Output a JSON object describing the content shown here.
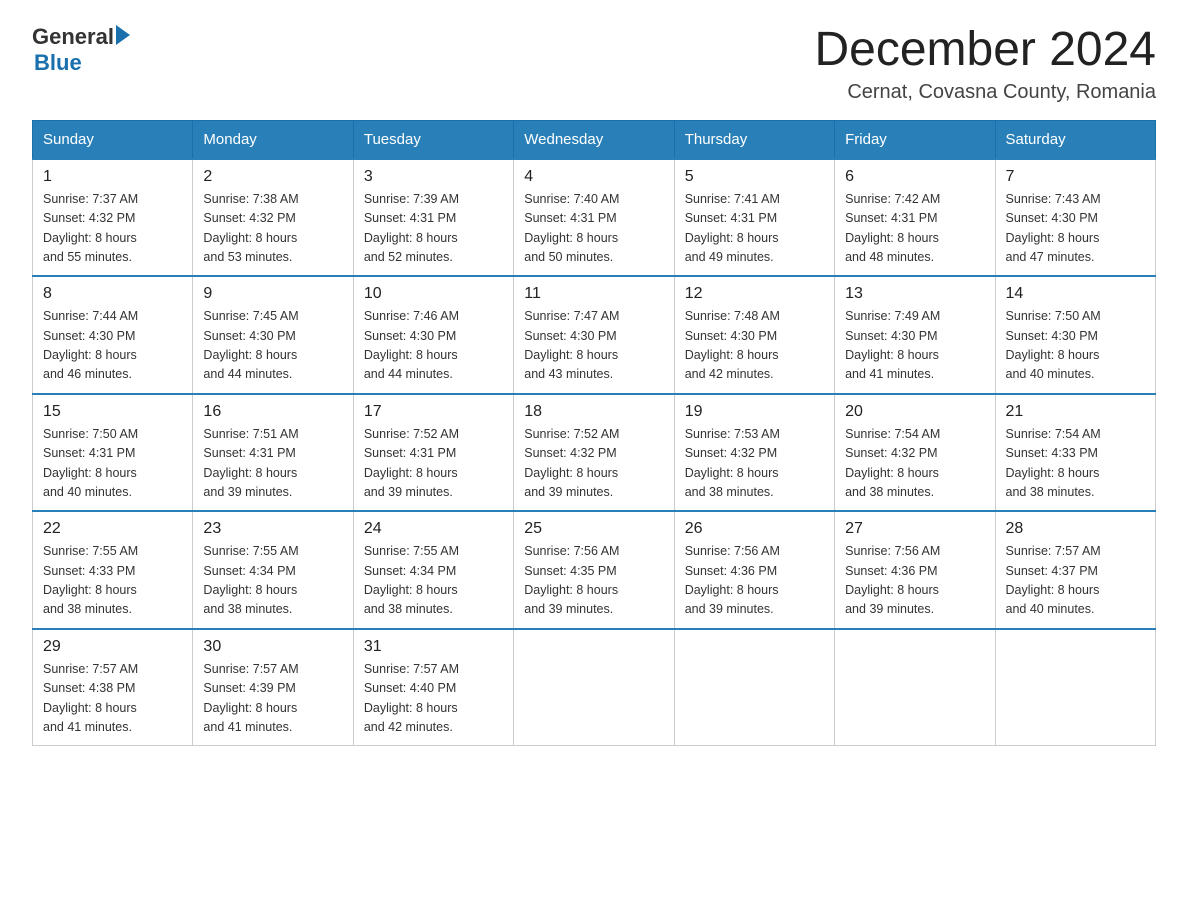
{
  "logo": {
    "text1": "General",
    "text2": "Blue"
  },
  "title": "December 2024",
  "subtitle": "Cernat, Covasna County, Romania",
  "days_of_week": [
    "Sunday",
    "Monday",
    "Tuesday",
    "Wednesday",
    "Thursday",
    "Friday",
    "Saturday"
  ],
  "weeks": [
    [
      {
        "day": "1",
        "sunrise": "7:37 AM",
        "sunset": "4:32 PM",
        "daylight": "8 hours and 55 minutes."
      },
      {
        "day": "2",
        "sunrise": "7:38 AM",
        "sunset": "4:32 PM",
        "daylight": "8 hours and 53 minutes."
      },
      {
        "day": "3",
        "sunrise": "7:39 AM",
        "sunset": "4:31 PM",
        "daylight": "8 hours and 52 minutes."
      },
      {
        "day": "4",
        "sunrise": "7:40 AM",
        "sunset": "4:31 PM",
        "daylight": "8 hours and 50 minutes."
      },
      {
        "day": "5",
        "sunrise": "7:41 AM",
        "sunset": "4:31 PM",
        "daylight": "8 hours and 49 minutes."
      },
      {
        "day": "6",
        "sunrise": "7:42 AM",
        "sunset": "4:31 PM",
        "daylight": "8 hours and 48 minutes."
      },
      {
        "day": "7",
        "sunrise": "7:43 AM",
        "sunset": "4:30 PM",
        "daylight": "8 hours and 47 minutes."
      }
    ],
    [
      {
        "day": "8",
        "sunrise": "7:44 AM",
        "sunset": "4:30 PM",
        "daylight": "8 hours and 46 minutes."
      },
      {
        "day": "9",
        "sunrise": "7:45 AM",
        "sunset": "4:30 PM",
        "daylight": "8 hours and 44 minutes."
      },
      {
        "day": "10",
        "sunrise": "7:46 AM",
        "sunset": "4:30 PM",
        "daylight": "8 hours and 44 minutes."
      },
      {
        "day": "11",
        "sunrise": "7:47 AM",
        "sunset": "4:30 PM",
        "daylight": "8 hours and 43 minutes."
      },
      {
        "day": "12",
        "sunrise": "7:48 AM",
        "sunset": "4:30 PM",
        "daylight": "8 hours and 42 minutes."
      },
      {
        "day": "13",
        "sunrise": "7:49 AM",
        "sunset": "4:30 PM",
        "daylight": "8 hours and 41 minutes."
      },
      {
        "day": "14",
        "sunrise": "7:50 AM",
        "sunset": "4:30 PM",
        "daylight": "8 hours and 40 minutes."
      }
    ],
    [
      {
        "day": "15",
        "sunrise": "7:50 AM",
        "sunset": "4:31 PM",
        "daylight": "8 hours and 40 minutes."
      },
      {
        "day": "16",
        "sunrise": "7:51 AM",
        "sunset": "4:31 PM",
        "daylight": "8 hours and 39 minutes."
      },
      {
        "day": "17",
        "sunrise": "7:52 AM",
        "sunset": "4:31 PM",
        "daylight": "8 hours and 39 minutes."
      },
      {
        "day": "18",
        "sunrise": "7:52 AM",
        "sunset": "4:32 PM",
        "daylight": "8 hours and 39 minutes."
      },
      {
        "day": "19",
        "sunrise": "7:53 AM",
        "sunset": "4:32 PM",
        "daylight": "8 hours and 38 minutes."
      },
      {
        "day": "20",
        "sunrise": "7:54 AM",
        "sunset": "4:32 PM",
        "daylight": "8 hours and 38 minutes."
      },
      {
        "day": "21",
        "sunrise": "7:54 AM",
        "sunset": "4:33 PM",
        "daylight": "8 hours and 38 minutes."
      }
    ],
    [
      {
        "day": "22",
        "sunrise": "7:55 AM",
        "sunset": "4:33 PM",
        "daylight": "8 hours and 38 minutes."
      },
      {
        "day": "23",
        "sunrise": "7:55 AM",
        "sunset": "4:34 PM",
        "daylight": "8 hours and 38 minutes."
      },
      {
        "day": "24",
        "sunrise": "7:55 AM",
        "sunset": "4:34 PM",
        "daylight": "8 hours and 38 minutes."
      },
      {
        "day": "25",
        "sunrise": "7:56 AM",
        "sunset": "4:35 PM",
        "daylight": "8 hours and 39 minutes."
      },
      {
        "day": "26",
        "sunrise": "7:56 AM",
        "sunset": "4:36 PM",
        "daylight": "8 hours and 39 minutes."
      },
      {
        "day": "27",
        "sunrise": "7:56 AM",
        "sunset": "4:36 PM",
        "daylight": "8 hours and 39 minutes."
      },
      {
        "day": "28",
        "sunrise": "7:57 AM",
        "sunset": "4:37 PM",
        "daylight": "8 hours and 40 minutes."
      }
    ],
    [
      {
        "day": "29",
        "sunrise": "7:57 AM",
        "sunset": "4:38 PM",
        "daylight": "8 hours and 41 minutes."
      },
      {
        "day": "30",
        "sunrise": "7:57 AM",
        "sunset": "4:39 PM",
        "daylight": "8 hours and 41 minutes."
      },
      {
        "day": "31",
        "sunrise": "7:57 AM",
        "sunset": "4:40 PM",
        "daylight": "8 hours and 42 minutes."
      },
      null,
      null,
      null,
      null
    ]
  ],
  "labels": {
    "sunrise": "Sunrise:",
    "sunset": "Sunset:",
    "daylight": "Daylight:"
  }
}
